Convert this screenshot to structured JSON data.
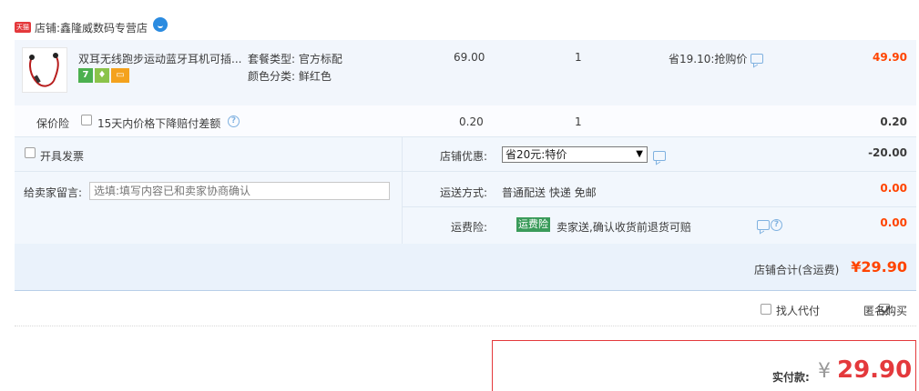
{
  "shop": {
    "badge": "天猫",
    "prefix": "店铺:",
    "name": "鑫隆威数码专营店"
  },
  "item": {
    "title": "双耳无线跑步运动蓝牙耳机可插...",
    "icon_seven": "7",
    "sku_package": "套餐类型: 官方标配",
    "sku_color": "颜色分类: 鲜红色",
    "price": "69.00",
    "quantity": "1",
    "promo": "省19.10:抢购价",
    "subtotal": "49.90"
  },
  "insurance": {
    "label": "保价险",
    "text": "15天内价格下降赔付差额",
    "price": "0.20",
    "quantity": "1",
    "subtotal": "0.20"
  },
  "invoice": {
    "label": "开具发票"
  },
  "message": {
    "label": "给卖家留言:",
    "placeholder": "选填:填写内容已和卖家协商确认"
  },
  "discount": {
    "label": "店铺优惠:",
    "selected": "省20元:特价",
    "amount": "-20.00"
  },
  "shipping": {
    "label": "运送方式:",
    "value": "普通配送 快递 免邮",
    "amount": "0.00"
  },
  "freight_insurance": {
    "label": "运费险:",
    "badge": "运费险",
    "text": "卖家送,确认收货前退货可赔",
    "amount": "0.00"
  },
  "store_total": {
    "label": "店铺合计(含运费)",
    "amount": "¥29.90"
  },
  "pay_options": {
    "proxy_label": "找人代付",
    "anon_label": "匿名购买"
  },
  "payment": {
    "label": "实付款:",
    "currency": "¥",
    "amount": "29.90"
  },
  "colors": {
    "price_accent": "#ff4400",
    "pay_accent": "#e4393c",
    "panel_bg": "#f2f7fd",
    "link_blue": "#7fb1e0",
    "freight_badge": "#3a9b5a"
  }
}
